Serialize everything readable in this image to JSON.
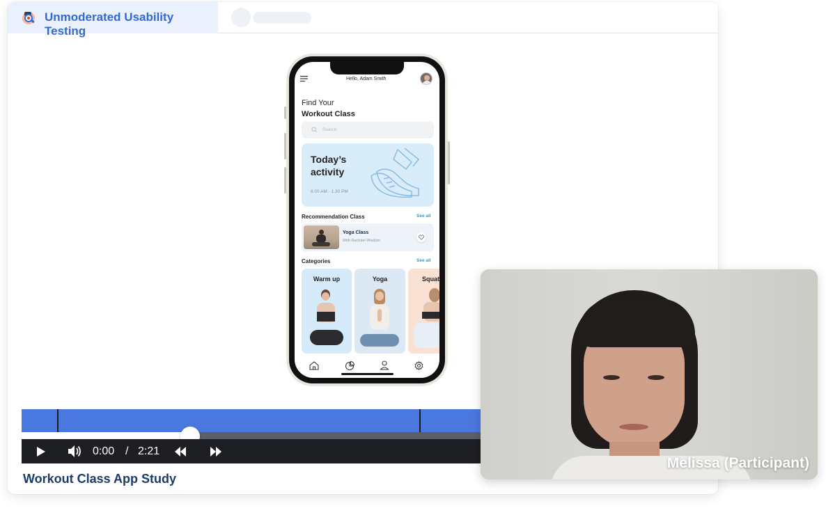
{
  "app": {
    "title": "Unmoderated Usability Testing"
  },
  "phone_app": {
    "greeting": "Hello, Adam Smith",
    "heading_line1": "Find Your",
    "heading_line2": "Workout Class",
    "search_placeholder": "Search",
    "activity_title_line1": "Today’s",
    "activity_title_line2": "activity",
    "activity_time": "8.00 AM - 1.30 PM",
    "recommendation_header": "Recommendation Class",
    "see_all": "See all",
    "recommended_class": {
      "name": "Yoga Class",
      "instructor": "With Rachael Wisdom"
    },
    "categories_header": "Categories",
    "categories": [
      "Warm up",
      "Yoga",
      "Squat"
    ]
  },
  "player": {
    "current_time": "0:00",
    "separator": "/",
    "duration": "2:21",
    "progress_fraction": 0.17
  },
  "study": {
    "title": "Workout Class App Study"
  },
  "webcam": {
    "participant_label": "Melissa (Participant)"
  },
  "colors": {
    "accent": "#2f6ad6",
    "tab_bg": "#eaf1fc",
    "video_bar": "#4b78df",
    "controls_bg": "#1e1f22",
    "study_title": "#1c3b67",
    "activity_card": "#d9ecf9"
  }
}
